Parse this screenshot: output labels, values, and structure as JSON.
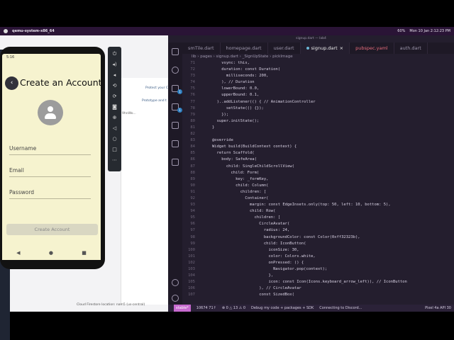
{
  "menubar": {
    "app_name": "qemu-system-x86_64",
    "battery": "60%",
    "clock": "Mon 10 Jan  2:12:23 PM"
  },
  "phone": {
    "status_time": "5:16",
    "title": "Create an Account",
    "back_icon": "arrow-left-icon",
    "fields": [
      "Username",
      "Email",
      "Password"
    ],
    "button_label": "Create Account"
  },
  "firebase": {
    "row1": "Protect your C",
    "row2": "Prototype and t",
    "row3": "9hnWo...",
    "footer": "Cloud Firestore location: nam5 (us-central)"
  },
  "vscode": {
    "window_title": "signup.dart — lab4",
    "tabs": [
      {
        "label": "smTile.dart",
        "active": false
      },
      {
        "label": "homepage.dart",
        "active": false
      },
      {
        "label": "user.dart",
        "active": false
      },
      {
        "label": "signup.dart",
        "active": true
      },
      {
        "label": "pubspec.yaml",
        "active": false
      },
      {
        "label": "auth.dart",
        "active": false
      }
    ],
    "breadcrumb": "lib › pages › signup.dart › _SignUpState › pickImage",
    "lines": [
      {
        "n": "71",
        "code": "    vsync: this,"
      },
      {
        "n": "72",
        "code": "    duration: const Duration("
      },
      {
        "n": "73",
        "code": "      milliseconds: 200,"
      },
      {
        "n": "74",
        "code": "    ), // Duration"
      },
      {
        "n": "75",
        "code": "    lowerBound: 0.0,"
      },
      {
        "n": "76",
        "code": "    upperBound: 0.1,"
      },
      {
        "n": "77",
        "code": "  )..addListener(() { // AnimationController"
      },
      {
        "n": "78",
        "code": "      setState(() {});"
      },
      {
        "n": "79",
        "code": "    });"
      },
      {
        "n": "80",
        "code": "  super.initState();"
      },
      {
        "n": "81",
        "code": "}"
      },
      {
        "n": "82",
        "code": ""
      },
      {
        "n": "83",
        "code": "@override"
      },
      {
        "n": "84",
        "code": "Widget build(BuildContext context) {"
      },
      {
        "n": "85",
        "code": "  return Scaffold("
      },
      {
        "n": "86",
        "code": "    body: SafeArea("
      },
      {
        "n": "87",
        "code": "      child: SingleChildScrollView("
      },
      {
        "n": "88",
        "code": "        child: Form("
      },
      {
        "n": "89",
        "code": "          key: _formKey,"
      },
      {
        "n": "90",
        "code": "          child: Column("
      },
      {
        "n": "91",
        "code": "            children: ["
      },
      {
        "n": "92",
        "code": "              Container("
      },
      {
        "n": "93",
        "code": "                margin: const EdgeInsets.only(top: 50, left: 10, bottom: 5),"
      },
      {
        "n": "94",
        "code": "                child: Row("
      },
      {
        "n": "95",
        "code": "                  children: ["
      },
      {
        "n": "96",
        "code": "                    CircleAvatar("
      },
      {
        "n": "97",
        "code": "                      radius: 24,"
      },
      {
        "n": "98",
        "code": "                      backgroundColor: const Color(0xff32323b),"
      },
      {
        "n": "99",
        "code": "                      child: IconButton("
      },
      {
        "n": "100",
        "code": "                        iconSize: 30,"
      },
      {
        "n": "101",
        "code": "                        color: Colors.white,"
      },
      {
        "n": "102",
        "code": "                        onPressed: () {"
      },
      {
        "n": "103",
        "code": "                          Navigator.pop(context);"
      },
      {
        "n": "104",
        "code": "                        },"
      },
      {
        "n": "105",
        "code": "                        icon: const Icon(Icons.keyboard_arrow_left)), // IconButton"
      },
      {
        "n": "106",
        "code": "                    ), // CircleAvatar"
      },
      {
        "n": "107",
        "code": "                    const SizedBox("
      }
    ],
    "status": {
      "remote": "stable*",
      "sync": "10674 71↑",
      "problems": "⊗ 0 △ 13 ⚠ 0",
      "debug": "Debug my code + packages + SDK",
      "connecting": "Connecting to Discord...",
      "device": "Pixel 4a API 30"
    }
  }
}
